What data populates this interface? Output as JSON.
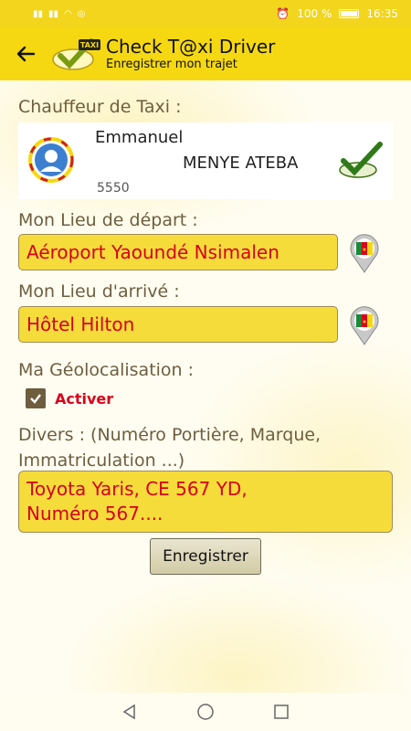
{
  "status_bar": {
    "battery_text": "100 %",
    "time": "16:35"
  },
  "app_bar": {
    "title": "Check T@xi Driver",
    "subtitle": "Enregistrer mon trajet",
    "logo_text": "TAXI"
  },
  "driver": {
    "section_label": "Chauffeur de Taxi :",
    "first_name": "Emmanuel",
    "last_name": "MENYE ATEBA",
    "id": "5550"
  },
  "departure": {
    "label": "Mon Lieu de départ :",
    "value": "Aéroport Yaoundé Nsimalen"
  },
  "arrival": {
    "label": "Mon Lieu d'arrivé :",
    "value": "Hôtel Hilton"
  },
  "geolocation": {
    "label": "Ma Géolocalisation :",
    "checkbox_label": "Activer",
    "checked": true
  },
  "misc": {
    "label": "Divers : (Numéro Portière, Marque, Immatriculation ...)",
    "value": "Toyota Yaris, CE 567 YD,\nNuméro 567...."
  },
  "actions": {
    "submit_label": "Enregistrer"
  },
  "icons": {
    "back": "arrow-left-icon",
    "pin": "cameroon-flag-pin-icon",
    "certified": "certified-check-icon",
    "avatar": "driver-avatar-icon"
  },
  "colors": {
    "primary": "#f5d812",
    "field_bg": "#f6dc3a",
    "field_text": "#d8001c",
    "label_text": "#6e5e3e"
  }
}
